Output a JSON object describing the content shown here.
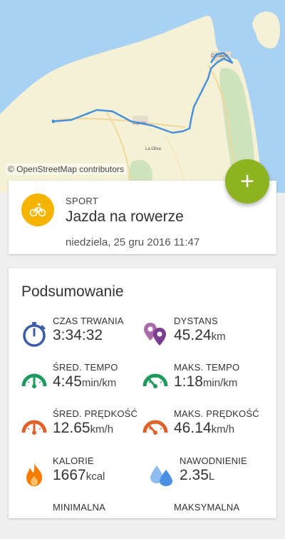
{
  "map": {
    "attribution": "© OpenStreetMap contributors",
    "labels": {
      "corralejo": "Corralejo",
      "lajares": "Lajares",
      "la_oliva": "La Oliva"
    },
    "route_color": "#4a8fdc"
  },
  "fab": {
    "label": "+"
  },
  "sport": {
    "kicker": "SPORT",
    "name": "Jazda na rowerze",
    "datetime": "niedziela, 25 gru 2016 11:47",
    "icon": "bicycle-icon",
    "icon_color": "#f4b400"
  },
  "summary": {
    "title": "Podsumowanie",
    "metrics": [
      {
        "label": "CZAS TRWANIA",
        "value": "3:34:32",
        "unit": "",
        "icon": "stopwatch-icon"
      },
      {
        "label": "DYSTANS",
        "value": "45.24",
        "unit": "km",
        "icon": "distance-pins-icon"
      },
      {
        "label": "ŚRED. TEMPO",
        "value": "4:45",
        "unit": "min/km",
        "icon": "avg-pace-gauge-icon"
      },
      {
        "label": "MAKS. TEMPO",
        "value": "1:18",
        "unit": "min/km",
        "icon": "max-pace-gauge-icon"
      },
      {
        "label": "ŚRED. PRĘDKOŚĆ",
        "value": "12.65",
        "unit": "km/h",
        "icon": "avg-speed-gauge-icon"
      },
      {
        "label": "MAKS. PRĘDKOŚĆ",
        "value": "46.14",
        "unit": "km/h",
        "icon": "max-speed-gauge-icon"
      },
      {
        "label": "KALORIE",
        "value": "1667",
        "unit": "kcal",
        "icon": "flame-icon"
      },
      {
        "label": "NAWODNIENIE",
        "value": "2.35",
        "unit": "L",
        "icon": "water-drops-icon"
      },
      {
        "label": "MINIMALNA",
        "value": "",
        "unit": "",
        "icon": ""
      },
      {
        "label": "MAKSYMALNA",
        "value": "",
        "unit": "",
        "icon": ""
      }
    ]
  },
  "colors": {
    "accent_green": "#8db321",
    "pace_green": "#1e9a5e",
    "speed_orange": "#e0622a",
    "duration_blue": "#3c5da6",
    "distance_purple": "#7b3d8f",
    "calorie_orange": "#f57c00",
    "water_blue": "#4a90e2"
  }
}
